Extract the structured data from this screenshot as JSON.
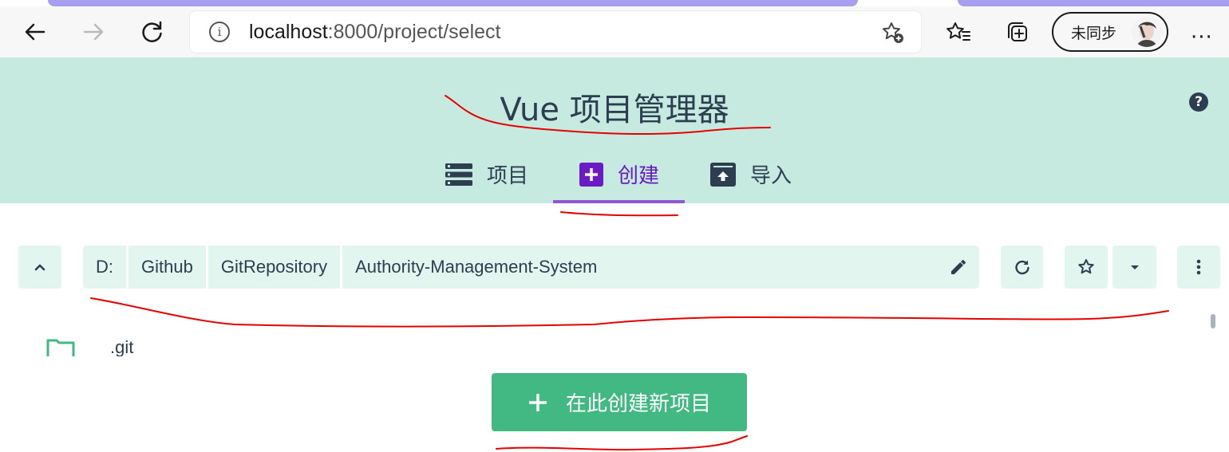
{
  "browser": {
    "url_host": "localhost",
    "url_path": ":8000/project/select",
    "sync_label": "未同步",
    "more_label": "···"
  },
  "app": {
    "title": "Vue 项目管理器",
    "help_label": "?",
    "tabs": [
      {
        "label": "项目",
        "active": false
      },
      {
        "label": "创建",
        "active": true
      },
      {
        "label": "导入",
        "active": false
      }
    ]
  },
  "path_bar": {
    "crumbs": [
      "D:",
      "Github",
      "GitRepository",
      "Authority-Management-System"
    ]
  },
  "folders": [
    {
      "name": ".git"
    }
  ],
  "create_button": {
    "label": "在此创建新项目"
  },
  "colors": {
    "header_bg": "#c6eadf",
    "active_tab": "#6a1bc4",
    "primary": "#42b983",
    "annotation": "#e60000"
  }
}
